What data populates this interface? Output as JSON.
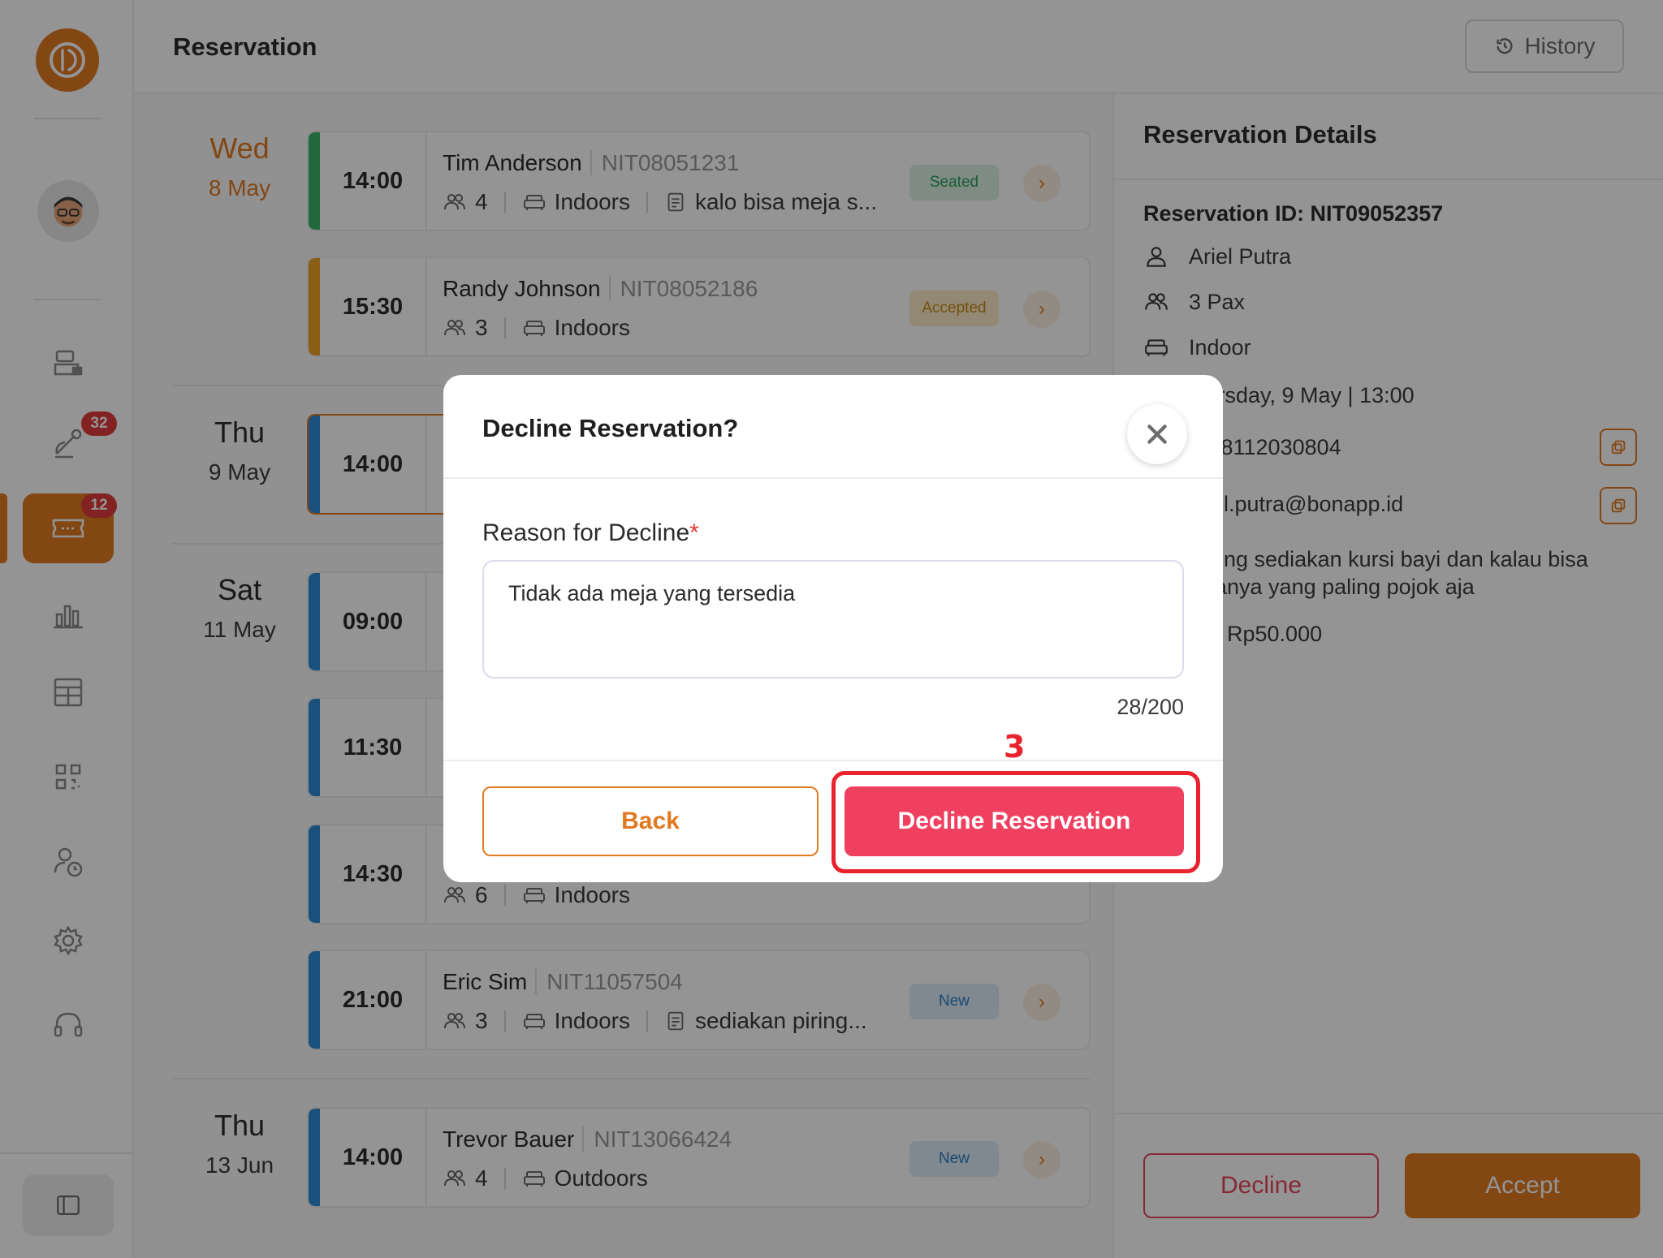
{
  "app": {
    "page_title": "Reservation",
    "history_label": "History"
  },
  "sidebar": {
    "badges": {
      "orders": "32",
      "reservations": "12"
    }
  },
  "groups": [
    {
      "dow": "Wed",
      "dm": "8 May"
    },
    {
      "dow": "Thu",
      "dm": "9 May"
    },
    {
      "dow": "Sat",
      "dm": "11 May"
    },
    {
      "dow": "Thu",
      "dm": "13 Jun"
    }
  ],
  "reservations": [
    {
      "time": "14:00",
      "name": "Tim Anderson",
      "nit": "NIT08051231",
      "pax": "4",
      "area": "Indoors",
      "note": "kalo bisa meja s...",
      "status": "Seated"
    },
    {
      "time": "15:30",
      "name": "Randy Johnson",
      "nit": "NIT08052186",
      "pax": "3",
      "area": "Indoors",
      "note": "",
      "status": "Accepted"
    },
    {
      "time": "14:00"
    },
    {
      "time": "09:00"
    },
    {
      "time": "11:30"
    },
    {
      "time": "14:30",
      "pax": "6",
      "area": "Indoors"
    },
    {
      "time": "21:00",
      "name": "Eric Sim",
      "nit": "NIT11057504",
      "pax": "3",
      "area": "Indoors",
      "note": "sediakan piring...",
      "status": "New"
    },
    {
      "time": "14:00",
      "name": "Trevor Bauer",
      "nit": "NIT13066424",
      "pax": "4",
      "area": "Outdoors",
      "note": "",
      "status": "New"
    }
  ],
  "details": {
    "title": "Reservation Details",
    "id_line": "Reservation ID: NIT09052357",
    "name": "Ariel Putra",
    "pax": "3 Pax",
    "area": "Indoor",
    "datetime": "ırsday, 9 May | 13:00",
    "phone": ":8112030804",
    "email": "el.putra@bonapp.id",
    "note_line1": "ong sediakan kursi bayi dan kalau bisa",
    "note_line2": "anya yang paling pojok aja",
    "deposit": ": Rp50.000",
    "decline_label": "Decline",
    "accept_label": "Accept"
  },
  "modal": {
    "title": "Decline Reservation?",
    "reason_label": "Reason for Decline",
    "required_mark": "*",
    "reason_value": "Tidak ada meja yang tersedia",
    "counter": "28/200",
    "back_label": "Back",
    "decline_label": "Decline Reservation"
  },
  "annotation": {
    "step": "3"
  },
  "colors": {
    "accent": "#e07a22",
    "danger": "#ef4060",
    "annotation": "#e8232d",
    "seated": "#2e9e5b",
    "accepted": "#c68a16",
    "new": "#2d7fc6"
  }
}
